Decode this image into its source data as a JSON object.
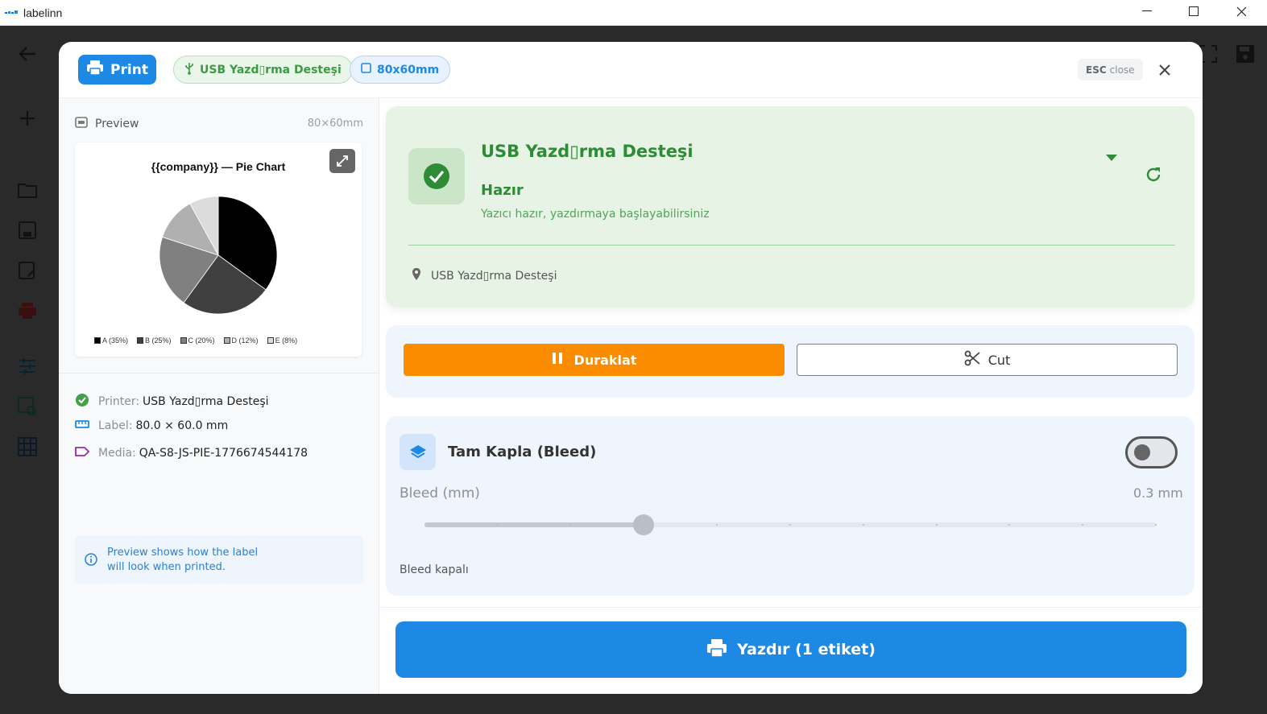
{
  "window": {
    "title": "labelinn"
  },
  "header": {
    "print_label": "Print",
    "printer_chip": "USB Yazd▯rma Desteşi",
    "size_chip": "80x60mm",
    "esc_key": "ESC",
    "esc_hint": "close"
  },
  "preview": {
    "label": "Preview",
    "size": "80×60mm",
    "chart_title": "{{company}} — Pie Chart",
    "legend": [
      "A (35%)",
      "B (25%)",
      "C (20%)",
      "D (12%)",
      "E (8%)"
    ]
  },
  "chart_data": {
    "type": "pie",
    "title": "{{company}} — Pie Chart",
    "categories": [
      "A",
      "B",
      "C",
      "D",
      "E"
    ],
    "values": [
      35,
      25,
      20,
      12,
      8
    ],
    "colors": [
      "#000000",
      "#404040",
      "#808080",
      "#b0b0b0",
      "#dcdcdc"
    ],
    "legend_position": "bottom"
  },
  "info": {
    "printer_key": "Printer:",
    "printer_val": "USB Yazd▯rma Desteşi",
    "label_key": "Label:",
    "label_val": "80.0 × 60.0 mm",
    "media_key": "Media:",
    "media_val": "QA-S8-JS-PIE-1776674544178",
    "tip_line1": "Preview shows how the label",
    "tip_line2": "will look when printed."
  },
  "status": {
    "printer_name": "USB Yazd▯rma Desteşi",
    "state": "Hazır",
    "description": "Yazıcı hazır, yazdırmaya başlayabilirsiniz",
    "location": "USB Yazd▯rma Desteşi",
    "color": "#2e8b36"
  },
  "actions": {
    "pause_label": "Duraklat",
    "cut_label": "Cut"
  },
  "bleed": {
    "title": "Tam Kapla (Bleed)",
    "enabled": false,
    "slider_label": "Bleed (mm)",
    "value_text": "0.3 mm",
    "value": 0.3,
    "slider_fraction": 0.3,
    "status_text": "Bleed kapalı"
  },
  "print_button": {
    "label": "Yazdır (1 etiket)"
  }
}
